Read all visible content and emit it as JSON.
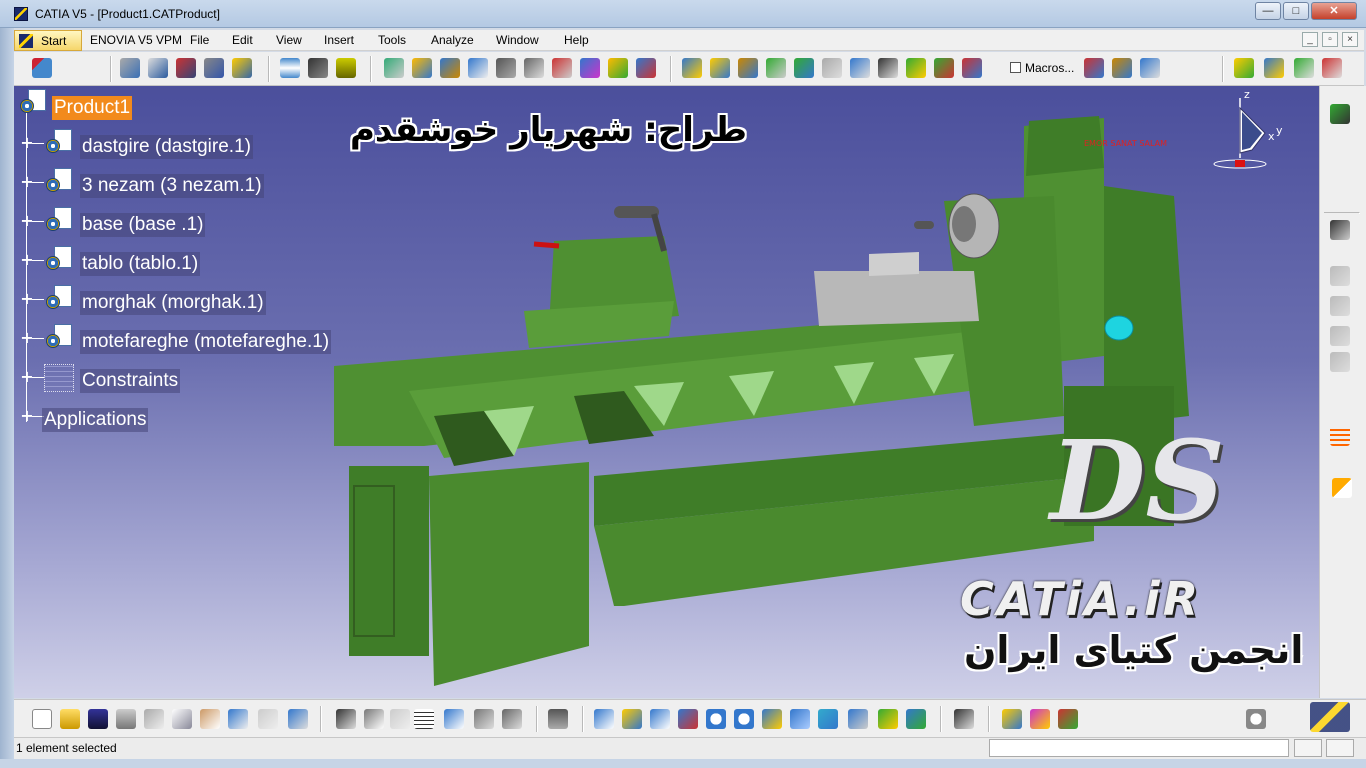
{
  "window": {
    "title": "CATIA V5 - [Product1.CATProduct]",
    "buttons": [
      "—",
      "□",
      "✕"
    ]
  },
  "menu": {
    "items": [
      "Start",
      "ENOVIA V5 VPM",
      "File",
      "Edit",
      "View",
      "Insert",
      "Tools",
      "Analyze",
      "Window",
      "Help"
    ],
    "mdi_buttons": [
      "_",
      "▫",
      "×"
    ]
  },
  "toolbar": {
    "macros_label": "Macros..."
  },
  "tree": {
    "root": "Product1",
    "children": [
      "dastgire (dastgire.1)",
      "3 nezam (3 nezam.1)",
      "base  (base .1)",
      "tablo (tablo.1)",
      "morghak (morghak.1)",
      "motefareghe (motefareghe.1)"
    ],
    "constraints": "Constraints",
    "applications": "Applications"
  },
  "overlay": {
    "designer": "طراح: شهریار خوشقدم",
    "site": "CATiA.iR",
    "association": "انجمن کتیای ایران",
    "ds_logo": "DS",
    "machine_plate": "EMOR SANAT SALAM"
  },
  "compass": {
    "z": "z",
    "x": "x",
    "y": "y"
  },
  "status": {
    "message": "1 element selected"
  },
  "colors": {
    "selected": "#f28a1c",
    "viewport_top": "#4b4f9c",
    "viewport_bottom": "#cfd0e8",
    "machine_green": "#4a8a2e"
  }
}
